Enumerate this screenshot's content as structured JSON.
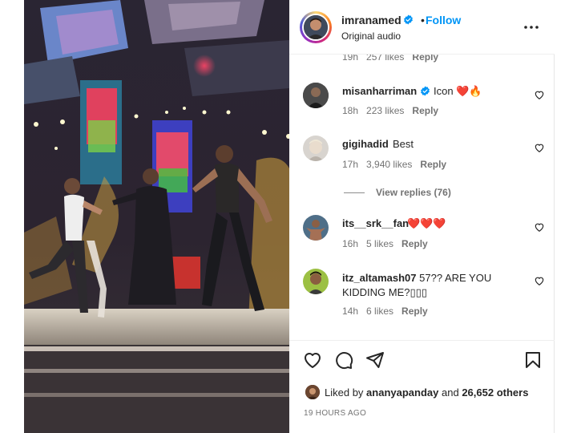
{
  "post": {
    "username": "imranamed",
    "dot": "•",
    "follow_label": "Follow",
    "audio": "Original audio"
  },
  "comments": [
    {
      "username": "",
      "text": "",
      "time": "19h",
      "likes": "257 likes",
      "reply": "Reply",
      "partial": true
    },
    {
      "username": "misanharriman",
      "text": "Icon ❤️🔥",
      "time": "18h",
      "likes": "223 likes",
      "reply": "Reply",
      "verified": true
    },
    {
      "username": "gigihadid",
      "text": "Best",
      "time": "17h",
      "likes": "3,940 likes",
      "reply": "Reply",
      "view_replies": "View replies (76)"
    },
    {
      "username": "its__srk__fan",
      "text": "❤️❤️❤️",
      "time": "16h",
      "likes": "5 likes",
      "reply": "Reply"
    },
    {
      "username": "itz_altamash07",
      "text": "57?? ARE YOU KIDDING ME?\u0000\u0000\u0000",
      "text_display": "57?? ARE YOU KIDDING ME?▯▯▯",
      "time": "14h",
      "likes": "6 likes",
      "reply": "Reply"
    }
  ],
  "footer": {
    "liked_by_prefix": "Liked by",
    "liked_by_user": "ananyapanday",
    "liked_by_suffix": "and",
    "others": "26,652 others",
    "timestamp": "19 HOURS AGO"
  },
  "colors": {
    "accent": "#0095f6",
    "text": "#262626",
    "muted": "#737373",
    "heart_red": "#ed4956"
  },
  "icons": {
    "like": "heart-outline-icon",
    "comment": "comment-icon",
    "share": "paper-plane-icon",
    "save": "bookmark-icon",
    "more": "more-options-icon",
    "verified": "verified-badge-icon"
  }
}
